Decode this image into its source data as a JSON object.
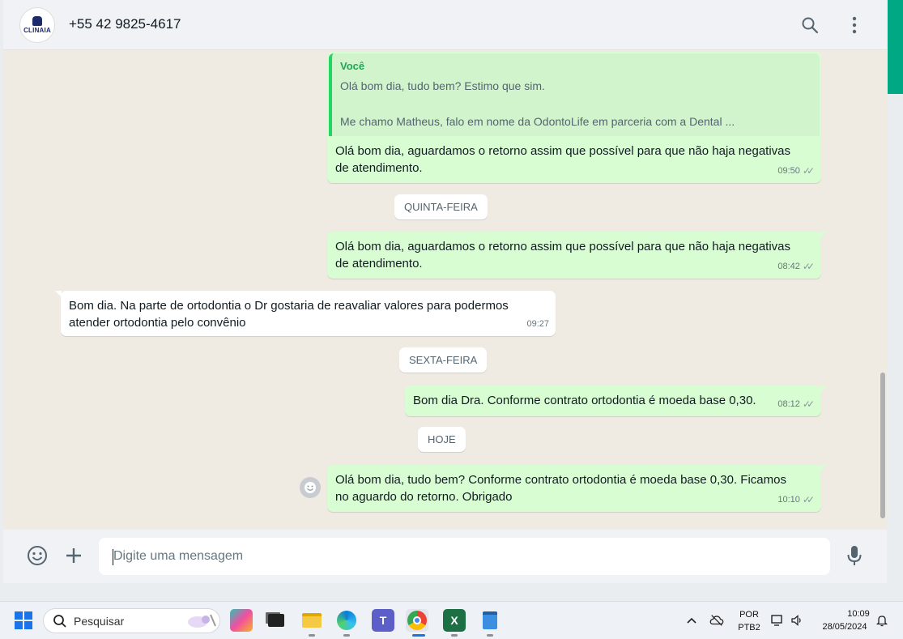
{
  "header": {
    "avatar_logo": "CLINAIA",
    "contact": "+55 42 9825-4617",
    "search_icon": "search-icon",
    "menu_icon": "kebab-menu-icon"
  },
  "messages": {
    "quote": {
      "author": "Você",
      "line1": "Olá bom dia, tudo bem? Estimo que sim.",
      "line2": "Me chamo Matheus, falo em nome da OdontoLife em parceria com a Dental ..."
    },
    "m1": {
      "line1": "Olá bom dia, aguardamos o retorno assim que possível para que não haja negativas",
      "line2": "de atendimento.",
      "time": "09:50"
    },
    "day1": "QUINTA-FEIRA",
    "m2": {
      "line1": "Olá bom dia, aguardamos o retorno assim que possível para que não haja negativas",
      "line2": "de atendimento.",
      "time": "08:42"
    },
    "m3": {
      "line1": "Bom dia. Na parte de ortodontia o Dr gostaria de reavaliar valores para podermos",
      "line2": "atender ortodontia pelo convênio",
      "time": "09:27"
    },
    "day2": "SEXTA-FEIRA",
    "m4": {
      "text": "Bom dia Dra. Conforme contrato ortodontia é moeda base 0,30.",
      "time": "08:12"
    },
    "day3": "HOJE",
    "m5": {
      "line1": "Olá bom dia, tudo bem? Conforme contrato ortodontia é moeda base 0,30. Ficamos",
      "line2": "no aguardo do retorno. Obrigado",
      "time": "10:10"
    },
    "read_tick": "✓✓"
  },
  "footer": {
    "placeholder": "Digite uma mensagem",
    "emoji_icon": "emoji-icon",
    "attach_icon": "plus-icon",
    "mic_icon": "microphone-icon"
  },
  "taskbar": {
    "search_label": "Pesquisar",
    "lang_top": "POR",
    "lang_bottom": "PTB2",
    "time": "10:09",
    "date": "28/05/2024",
    "apps": [
      "copilot-icon",
      "file-explorer-icon",
      "edge-icon",
      "teams-icon",
      "chrome-icon",
      "excel-icon",
      "notepad-icon"
    ]
  },
  "colors": {
    "outgoing_bubble": "#d9fdd3",
    "incoming_bubble": "#ffffff",
    "accent": "#00a884"
  }
}
